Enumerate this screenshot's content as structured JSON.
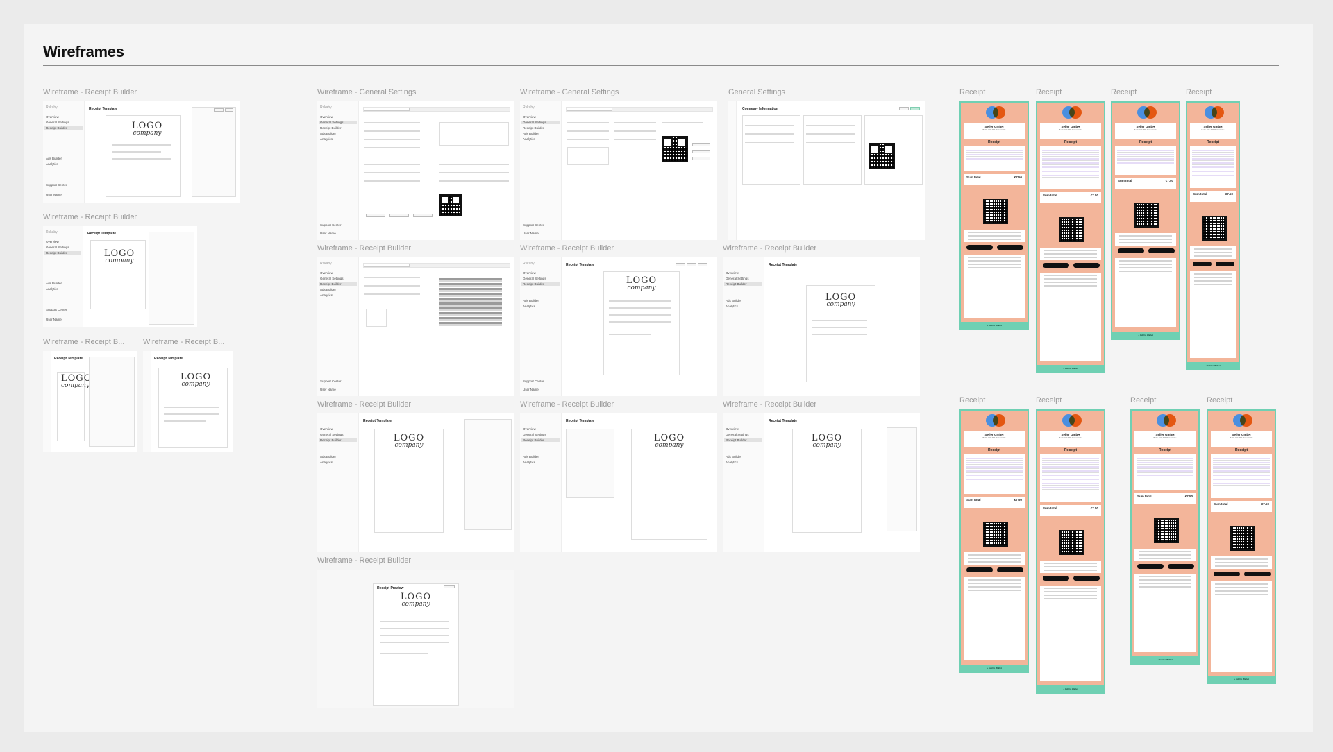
{
  "page": {
    "title": "Wireframes"
  },
  "frames": {
    "rb1": "Wireframe - Receipt Builder",
    "rb2": "Wireframe - Receipt Builder",
    "rb3": "Wireframe - Receipt B...",
    "rb4": "Wireframe - Receipt B...",
    "gs1": "Wireframe - General Settings",
    "gs2": "Wireframe - General Settings",
    "gs3": "General Settings",
    "rb5": "Wireframe - Receipt Builder",
    "rb6": "Wireframe - Receipt Builder",
    "rb7": "Wireframe - Receipt Builder",
    "rb8": "Wireframe - Receipt Builder",
    "rb9": "Wireframe - Receipt Builder",
    "rb10": "Wireframe - Receipt Builder",
    "rb11": "Wireframe - Receipt Builder"
  },
  "receipt_labels": [
    "Receipt",
    "Receipt",
    "Receipt",
    "Receipt",
    "Receipt",
    "Receipt",
    "Receipt",
    "Receipt"
  ],
  "wireframe": {
    "receipt_template": "Receipt Template",
    "receipt_preview": "Receipt Preview",
    "company_information": "Company Information",
    "logo_line1": "LOGO",
    "logo_line2": "company",
    "nav": [
      "Overview",
      "General Settings",
      "Receipt Builder",
      "Ads Builder",
      "Analytics"
    ],
    "brand": "Rskaby",
    "support": "Support Center",
    "user": "User Name"
  },
  "phone": {
    "seller": "Seller GmbH",
    "seller_sub": "Berlin 123 / 456 Musterstraße",
    "receipt_title": "Receipt",
    "sum_total": "Sum total",
    "sum_value": "€7.50",
    "add_to_wallet": "+ Add to Wallet"
  },
  "colors": {
    "canvas_bg": "#f4f4f4",
    "phone_peach": "#f3b59a",
    "phone_mint": "#6fd0b3",
    "blue": "#4a8fe0",
    "orange": "#f07a1c"
  }
}
